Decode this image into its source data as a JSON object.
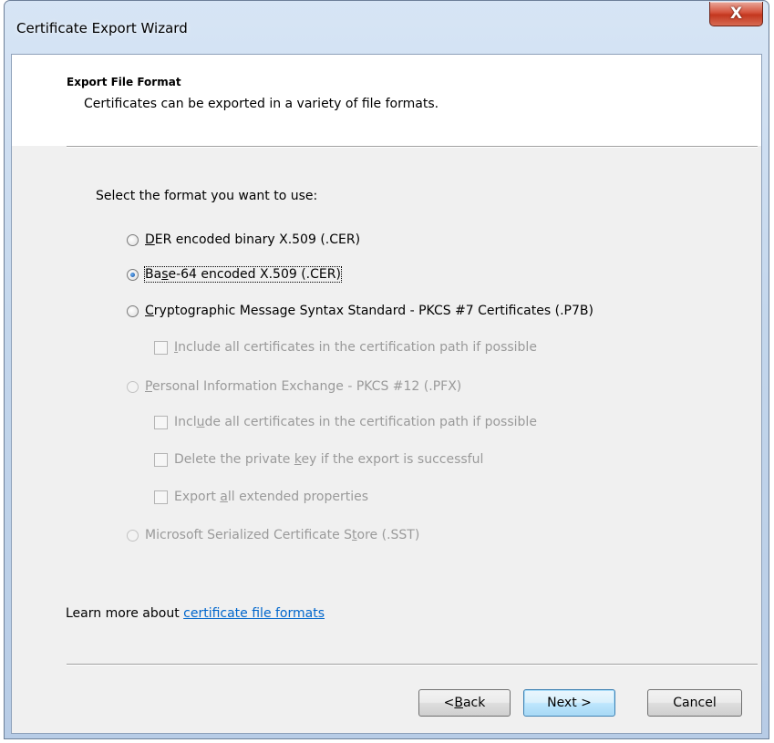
{
  "window": {
    "title": "Certificate Export Wizard",
    "close_glyph": "X"
  },
  "header": {
    "title": "Export File Format",
    "subtitle": "Certificates can be exported in a variety of file formats."
  },
  "prompt": "Select the format you want to use:",
  "options": [
    {
      "pre": "",
      "key": "D",
      "post": "ER encoded binary X.509 (.CER)",
      "checked": false,
      "enabled": true
    },
    {
      "pre": "Ba",
      "key": "s",
      "post": "e-64 encoded X.509 (.CER)",
      "checked": true,
      "enabled": true,
      "focused": true
    },
    {
      "pre": "",
      "key": "C",
      "post": "ryptographic Message Syntax Standard - PKCS #7 Certificates (.P7B)",
      "checked": false,
      "enabled": true
    },
    {
      "pre": "",
      "key": "P",
      "post": "ersonal Information Exchange - PKCS #12 (.PFX)",
      "checked": false,
      "enabled": false
    },
    {
      "pre": "Microsoft Serialized Certificate S",
      "key": "t",
      "post": "ore (.SST)",
      "checked": false,
      "enabled": false
    }
  ],
  "checkboxes": {
    "p7b_include": {
      "pre": "",
      "key": "I",
      "post": "nclude all certificates in the certification path if possible",
      "checked": false,
      "enabled": false
    },
    "pfx_include": {
      "pre": "Incl",
      "key": "u",
      "post": "de all certificates in the certification path if possible",
      "checked": false,
      "enabled": false
    },
    "pfx_delete": {
      "pre": "Delete the private ",
      "key": "k",
      "post": "ey if the export is successful",
      "checked": false,
      "enabled": false
    },
    "pfx_export": {
      "pre": "Export ",
      "key": "a",
      "post": "ll extended properties",
      "checked": false,
      "enabled": false
    }
  },
  "learn_more": {
    "text": "Learn more about ",
    "link": "certificate file formats"
  },
  "buttons": {
    "back": {
      "pre": "< ",
      "key": "B",
      "post": "ack"
    },
    "next": "Next >",
    "cancel": "Cancel"
  },
  "colors": {
    "link": "#0066cc",
    "disabled_text": "#9a9a9a",
    "close_button": "#c3371f",
    "frame": "#c3d6ec"
  }
}
